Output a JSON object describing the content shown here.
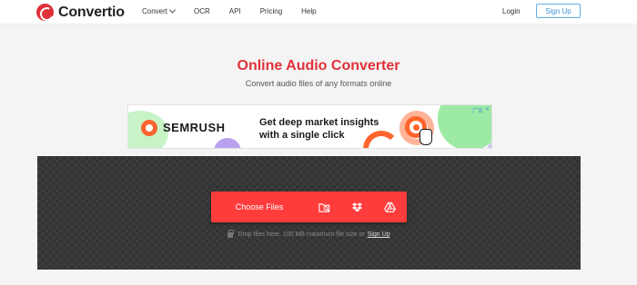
{
  "header": {
    "brand": "Convertio",
    "nav": [
      "Convert",
      "OCR",
      "API",
      "Pricing",
      "Help"
    ],
    "login": "Login",
    "signup": "Sign Up"
  },
  "hero": {
    "title": "Online Audio Converter",
    "subtitle": "Convert audio files of any formats online"
  },
  "ad": {
    "brand": "SEMRUSH",
    "line1": "Get deep market insights",
    "line2": "with a single click",
    "badge": "广告"
  },
  "upload": {
    "choose_label": "Choose Files",
    "sources": [
      "folder-search-icon",
      "dropbox-icon",
      "google-drive-icon"
    ],
    "hint": "Drop files here. 100 MB maximum file size or",
    "hint_link": "Sign Up"
  },
  "colors": {
    "accent": "#ff3c3c",
    "title_red": "#e0303a",
    "signup_blue": "#3a95d6",
    "dropzone": "#3b3b3b"
  }
}
